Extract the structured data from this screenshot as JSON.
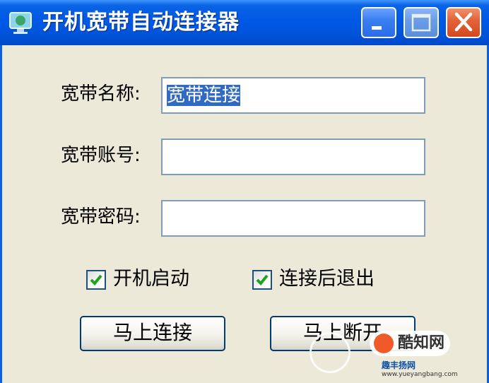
{
  "window": {
    "title": "开机宽带自动连接器",
    "app_icon": "monitor-globe-icon",
    "controls": {
      "minimize": "minimize-icon",
      "maximize": "maximize-icon",
      "close": "close-icon"
    }
  },
  "form": {
    "name_label": "宽带名称:",
    "name_value": "宽带连接",
    "account_label": "宽带账号:",
    "account_value": "",
    "password_label": "宽带密码:",
    "password_value": ""
  },
  "options": {
    "autostart_label": "开机启动",
    "autostart_checked": true,
    "exit_after_connect_label": "连接后退出",
    "exit_after_connect_checked": true
  },
  "buttons": {
    "connect_label": "马上连接",
    "disconnect_label": "马上断开"
  },
  "watermark": {
    "badge": "酷知网",
    "site": "趣丰扬网",
    "url": "www.yueyangbang.com"
  },
  "colors": {
    "title_bar": "#0058e6",
    "close_button": "#e3643a",
    "selection": "#316ac5",
    "dialog_bg": "#ece9d8"
  }
}
